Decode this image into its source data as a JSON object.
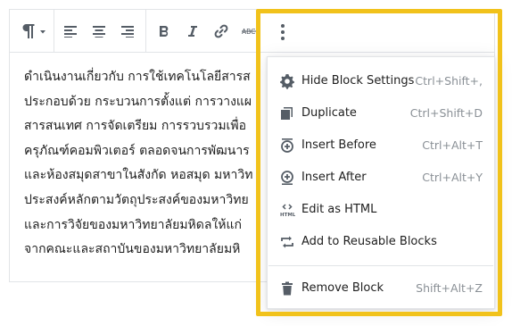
{
  "toolbar": {
    "buttons": [
      {
        "name": "paragraph-icon"
      },
      {
        "name": "align-left-icon"
      },
      {
        "name": "align-center-icon"
      },
      {
        "name": "align-right-icon"
      },
      {
        "name": "bold-icon"
      },
      {
        "name": "italic-icon"
      },
      {
        "name": "link-icon"
      },
      {
        "name": "strikethrough-icon"
      },
      {
        "name": "more-options-icon"
      }
    ]
  },
  "content": {
    "lines": [
      "ดำเนินงานเกี่ยวกับ การใช้เทคโนโลยีสารส",
      "ประกอบด้วย กระบวนการตั้งแต่ การวางแผ",
      "สารสนเทศ การจัดเตรียม การรวบรวมเพื่อ",
      "ครุภัณฑ์คอมพิวเตอร์ ตลอดจนการพัฒนาร",
      "และห้องสมุดสาขาในสังกัด หอสมุด มหาวิท",
      "ประสงค์หลักตามวัตถุประสงค์ของมหาวิทย",
      "และการวิจัยของมหาวิทยาลัยมหิดลให้แก่",
      "จากคณะและสถาบันของมหาวิทยาลัยมหิ"
    ]
  },
  "menu": {
    "items": [
      {
        "label": "Hide Block Settings",
        "shortcut": "Ctrl+Shift+,",
        "icon": "gear-icon"
      },
      {
        "label": "Duplicate",
        "shortcut": "Ctrl+Shift+D",
        "icon": "duplicate-icon"
      },
      {
        "label": "Insert Before",
        "shortcut": "Ctrl+Alt+T",
        "icon": "insert-before-icon"
      },
      {
        "label": "Insert After",
        "shortcut": "Ctrl+Alt+Y",
        "icon": "insert-after-icon"
      },
      {
        "label": "Edit as HTML",
        "shortcut": "",
        "icon": "html-icon"
      },
      {
        "label": "Add to Reusable Blocks",
        "shortcut": "",
        "icon": "reusable-block-icon"
      },
      {
        "label": "Remove Block",
        "shortcut": "Shift+Alt+Z",
        "icon": "trash-icon"
      }
    ]
  },
  "colors": {
    "highlight": "#f1c21b",
    "icon": "#555d66",
    "shortcut": "#8a9096",
    "border": "#e2e4e7"
  }
}
